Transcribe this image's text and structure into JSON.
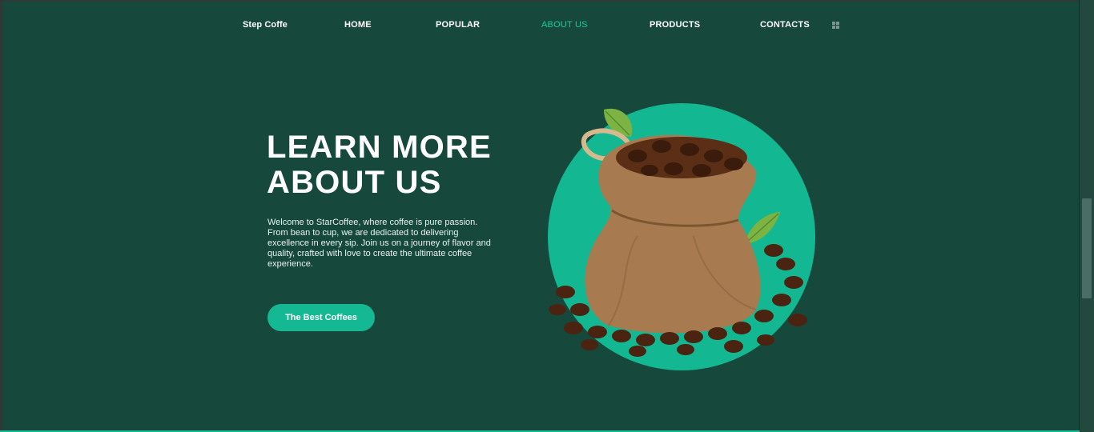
{
  "nav": {
    "brand": "Step Coffe",
    "items": [
      {
        "label": "HOME",
        "active": false
      },
      {
        "label": "POPULAR",
        "active": false
      },
      {
        "label": "ABOUT US",
        "active": true
      },
      {
        "label": "PRODUCTS",
        "active": false
      },
      {
        "label": "CONTACTS",
        "active": false
      }
    ],
    "menu_icon": "grid-icon"
  },
  "hero": {
    "title_line1": "LEARN MORE",
    "title_line2": "ABOUT US",
    "description": "Welcome to StarCoffee, where coffee is pure passion. From bean to cup, we are dedicated to delivering excellence in every sip. Join us on a journey of flavor and quality, crafted with love to create the ultimate coffee experience.",
    "button_label": "The Best Coffees",
    "image": "coffee-bean-sack-illustration"
  },
  "colors": {
    "background": "#16493c",
    "accent": "#14b893",
    "active_nav": "#1fc79d",
    "text": "#ffffff"
  }
}
